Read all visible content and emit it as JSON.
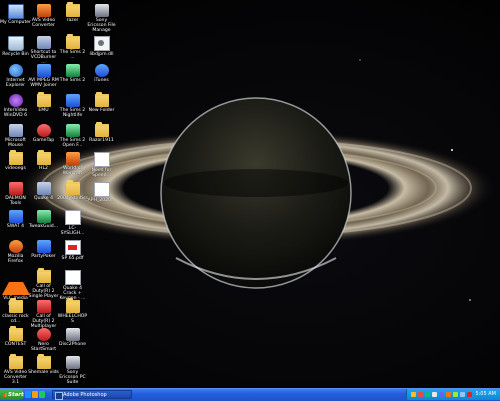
{
  "desktop": {
    "icons": [
      {
        "label": "My Computer",
        "icon": "computer-icon"
      },
      {
        "label": "AVS Video Converter",
        "icon": "video-converter-icon"
      },
      {
        "label": "razer",
        "icon": "folder-icon"
      },
      {
        "label": "Sony Ericsson File Manage",
        "icon": "sony-ericsson-icon"
      },
      {
        "label": "Recycle Bin",
        "icon": "recycle-bin-icon"
      },
      {
        "label": "Shortcut to VCDBurner ...",
        "icon": "vcdburner-icon"
      },
      {
        "label": "The Sims 2 ...",
        "icon": "sims-icon"
      },
      {
        "label": "libdjpm.dll",
        "icon": "dll-file-icon"
      },
      {
        "label": "Internet Explorer",
        "icon": "internet-explorer-icon"
      },
      {
        "label": "AVI MPEG RM WMV Joiner",
        "icon": "video-joiner-icon"
      },
      {
        "label": "The Sims 2",
        "icon": "sims-icon"
      },
      {
        "label": "iTunes",
        "icon": "itunes-icon"
      },
      {
        "label": "InterVideo WinDVD 6",
        "icon": "windvd-icon"
      },
      {
        "label": "EMU",
        "icon": "folder-icon"
      },
      {
        "label": "The Sims 2 Nightlife",
        "icon": "sims-icon"
      },
      {
        "label": "New Folder",
        "icon": "folder-icon"
      },
      {
        "label": "Microsoft Mouse",
        "icon": "mouse-icon"
      },
      {
        "label": "GameTap",
        "icon": "gametap-icon"
      },
      {
        "label": "The Sims 2 Open F...",
        "icon": "sims-icon"
      },
      {
        "label": "Razor1911",
        "icon": "folder-icon"
      },
      {
        "label": "videoegs",
        "icon": "folder-icon"
      },
      {
        "label": "HL2",
        "icon": "folder-icon"
      },
      {
        "label": "World of Warcraft",
        "icon": "warcraft-icon"
      },
      {
        "label": "Need for Speed...",
        "icon": "need-for-speed-icon"
      },
      {
        "label": "DAEMON Tools",
        "icon": "daemon-tools-icon"
      },
      {
        "label": "Quake 4",
        "icon": "quake-icon"
      },
      {
        "label": "2004_Stintiss",
        "icon": "folder-icon"
      },
      {
        "label": "APH_2020...",
        "icon": "document-icon"
      },
      {
        "label": "SWAT 4",
        "icon": "swat-icon"
      },
      {
        "label": "TweakGuid...",
        "icon": "tweakguides-icon"
      },
      {
        "label": "LC-SYSLIGH...",
        "icon": "document-icon"
      },
      {
        "label": "Mozilla Firefox",
        "icon": "firefox-icon"
      },
      {
        "label": "PartyPoker",
        "icon": "partypoker-icon"
      },
      {
        "label": "SP 65.pdf",
        "icon": "pdf-icon"
      },
      {
        "label": "VLC media player",
        "icon": "vlc-icon"
      },
      {
        "label": "Call of Duty(R) 2 Single Player",
        "icon": "call-of-duty-icon"
      },
      {
        "label": "Quake 4 Crack + Keygen - ...",
        "icon": "document-icon"
      },
      {
        "label": "classic rock cd...",
        "icon": "folder-icon"
      },
      {
        "label": "Call of Duty(R) 2 Multiplayer",
        "icon": "call-of-duty-icon"
      },
      {
        "label": "WHEELCHOPS",
        "icon": "folder-icon"
      },
      {
        "label": "CONTEST",
        "icon": "folder-icon"
      },
      {
        "label": "Nero StartSmart",
        "icon": "nero-icon"
      },
      {
        "label": "Disc2Phone",
        "icon": "disc2phone-icon"
      },
      {
        "label": "AVS Video Converter 3.1",
        "icon": "folder-icon"
      },
      {
        "label": "Shemale vids",
        "icon": "folder-icon"
      },
      {
        "label": "Sony Ericsson PC Suite",
        "icon": "sony-ericsson-icon"
      }
    ]
  },
  "taskbar": {
    "start_label": "Start",
    "active_window": "Adobe Photoshop",
    "clock": "5:05 AM"
  },
  "colors": {
    "taskbar": "#245edc",
    "start": "#2c8a2c",
    "tray": "#0f87d1"
  }
}
